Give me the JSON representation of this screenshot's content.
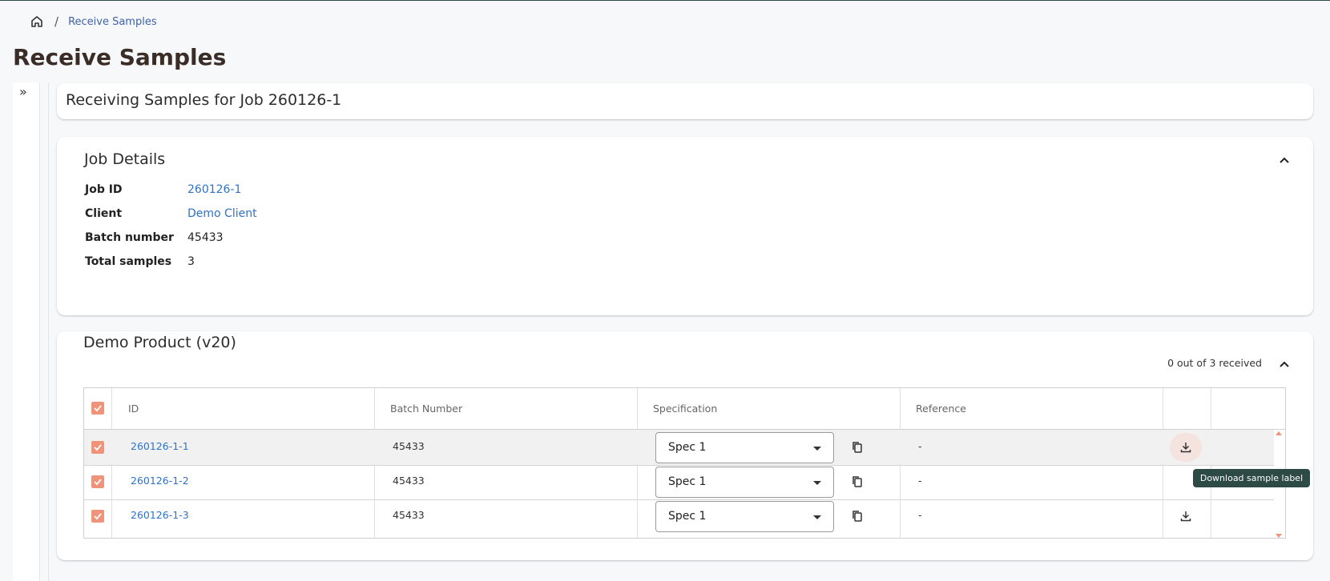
{
  "breadcrumb": {
    "home_icon": "home-icon",
    "separator": "/",
    "current": "Receive Samples"
  },
  "page_title": "Receive Samples",
  "sidebar": {
    "expand_label": "»"
  },
  "header_card": {
    "title": "Receiving Samples for Job 260126-1"
  },
  "job_details": {
    "title": "Job Details",
    "fields": [
      {
        "label": "Job ID",
        "value": "260126-1"
      },
      {
        "label": "Client",
        "value": "Demo Client"
      },
      {
        "label": "Batch number",
        "value": "45433"
      },
      {
        "label": "Total samples",
        "value": "3"
      }
    ]
  },
  "product": {
    "title": "Demo Product (v20)",
    "received_status": "0 out of 3 received",
    "columns": [
      "ID",
      "Batch Number",
      "Specification",
      "Reference"
    ],
    "rows": [
      {
        "id": "260126-1-1",
        "batch": "45433",
        "spec": "Spec 1",
        "reference": "-"
      },
      {
        "id": "260126-1-2",
        "batch": "45433",
        "spec": "Spec 1",
        "reference": "-"
      },
      {
        "id": "260126-1-3",
        "batch": "45433",
        "spec": "Spec 1",
        "reference": "-"
      }
    ]
  },
  "tooltip": {
    "text": "Download sample label"
  },
  "colors": {
    "accent": "#f0937b",
    "link": "#2f73c6",
    "tooltip_bg": "#2e4a44",
    "title": "#3a2d27"
  }
}
